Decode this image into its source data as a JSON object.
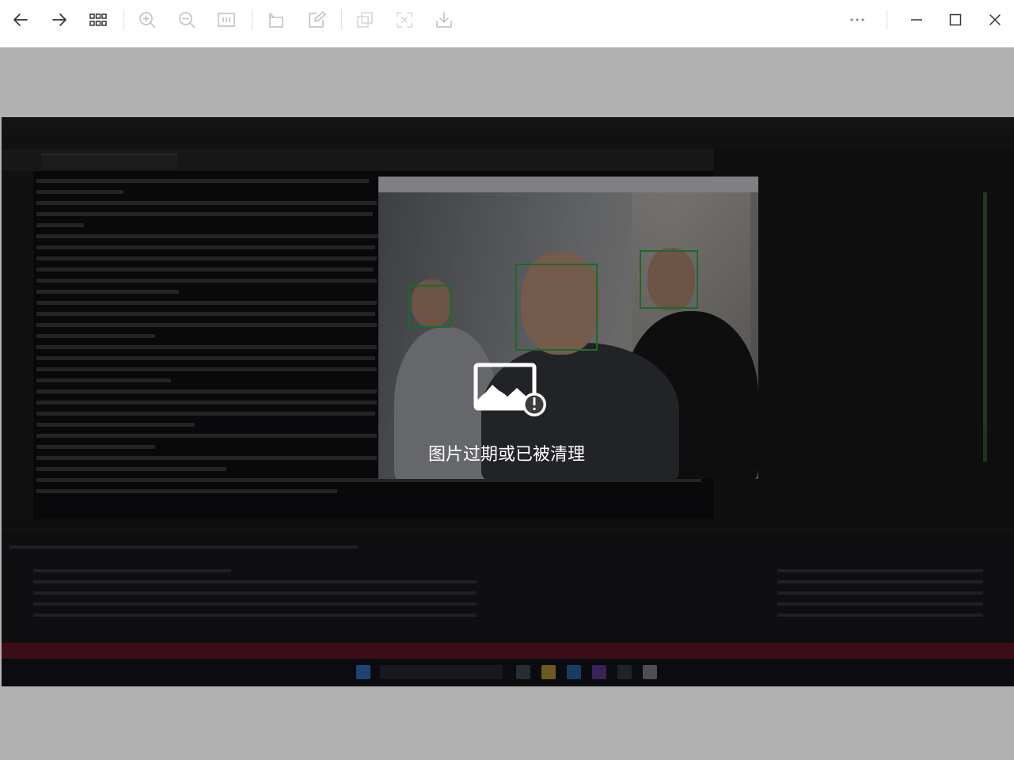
{
  "toolbar": {
    "buttons": [
      "back",
      "forward",
      "grid-view",
      "zoom-in",
      "zoom-out",
      "actual-size",
      "rotate",
      "edit",
      "copy",
      "extract-text",
      "download",
      "more",
      "minimize",
      "maximize",
      "close"
    ]
  },
  "viewer": {
    "status_message": "图片过期或已被清理"
  }
}
